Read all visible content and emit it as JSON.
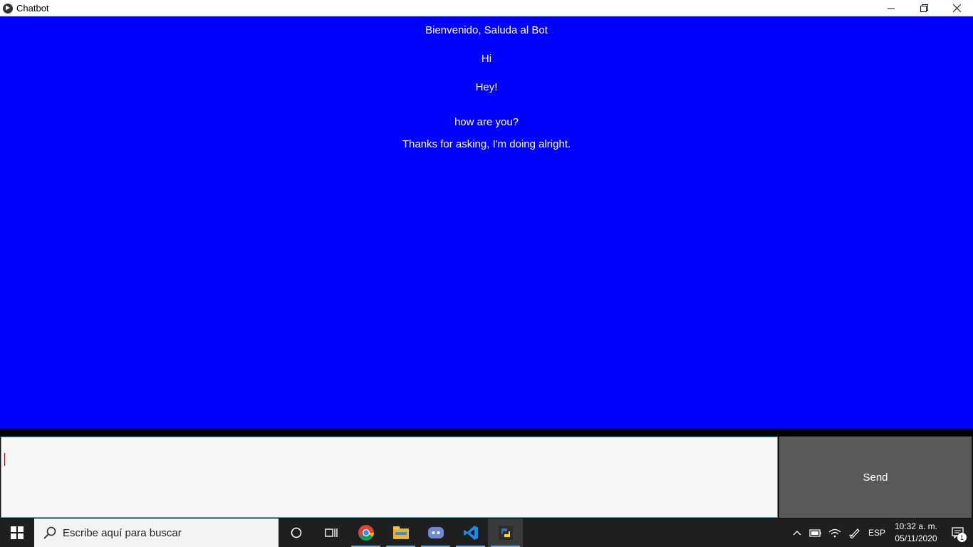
{
  "window": {
    "title": "Chatbot",
    "icon": "app-logo-icon",
    "controls": [
      "minimize-icon",
      "restore-icon",
      "close-icon"
    ]
  },
  "chat": {
    "background_color": "#0000ff",
    "messages": [
      "Bienvenido, Saluda al Bot",
      "Hi",
      "Hey!",
      "how are you?",
      "Thanks for asking, I'm doing alright."
    ]
  },
  "composer": {
    "input_value": "",
    "send_label": "Send"
  },
  "taskbar": {
    "search_placeholder": "Escribe aquí para buscar",
    "apps": [
      "chrome-icon",
      "file-explorer-icon",
      "discord-icon",
      "vscode-icon",
      "python-icon"
    ],
    "language": "ESP",
    "time": "10:32 a. m.",
    "date": "05/11/2020",
    "notification_count": "1"
  }
}
